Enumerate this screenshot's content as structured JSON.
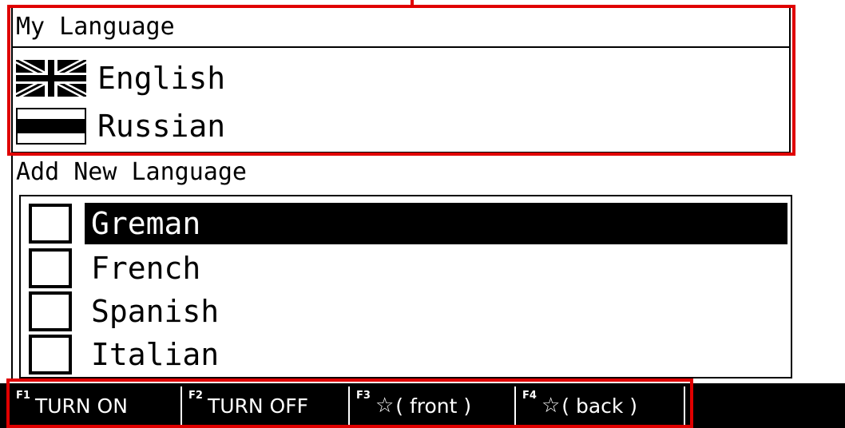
{
  "my_language": {
    "title": "My Language",
    "items": [
      {
        "label": "English",
        "flag": "uk-flag-icon"
      },
      {
        "label": "Russian",
        "flag": "striped-flag-icon"
      }
    ]
  },
  "add_language": {
    "title": "Add New Language",
    "items": [
      {
        "label": "Greman",
        "checked": false,
        "selected": true
      },
      {
        "label": "French",
        "checked": false,
        "selected": false
      },
      {
        "label": "Spanish",
        "checked": false,
        "selected": false
      },
      {
        "label": "Italian",
        "checked": false,
        "selected": false
      }
    ]
  },
  "fkeys": [
    {
      "key": "F1",
      "label": "TURN ON",
      "icon": null
    },
    {
      "key": "F2",
      "label": "TURN OFF",
      "icon": null
    },
    {
      "key": "F3",
      "label": "( front )",
      "icon": "star-icon"
    },
    {
      "key": "F4",
      "label": "( back )",
      "icon": "star-icon"
    }
  ],
  "colors": {
    "highlight": "#e00000",
    "selection_bg": "#000000",
    "fkey_bar_bg": "#000000"
  }
}
